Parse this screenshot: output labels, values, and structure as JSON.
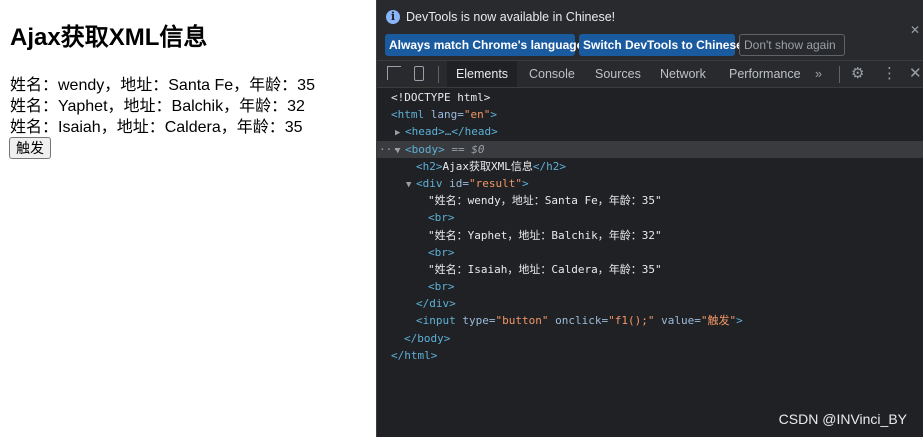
{
  "page": {
    "heading": "Ajax获取XML信息",
    "results": [
      "姓名：wendy，地址：Santa Fe，年龄：35",
      "姓名：Yaphet，地址：Balchik，年龄：32",
      "姓名：Isaiah，地址：Caldera，年龄：35"
    ],
    "button_label": "触发"
  },
  "devtools": {
    "infobar": {
      "message": "DevTools is now available in Chinese!",
      "match_label": "Always match Chrome's language",
      "switch_label": "Switch DevTools to Chinese",
      "dont_label": "Don't show again"
    },
    "tabs": {
      "elements": "Elements",
      "console": "Console",
      "sources": "Sources",
      "network": "Network",
      "performance": "Performance",
      "more": "»"
    },
    "icons": {
      "info": "info-icon",
      "close": "close-icon",
      "inspect": "inspect-element-icon",
      "device": "device-toolbar-icon",
      "settings": "gear-icon",
      "menu": "kebab-menu-icon"
    },
    "dom": {
      "doctype": "<!DOCTYPE html>",
      "html_open": "<html",
      "lang_attr": "lang",
      "lang_val": "\"en\"",
      "head": "<head>…</head>",
      "body_open": "<body>",
      "body_eq": "== $0",
      "h2_open": "<h2>",
      "h2_text": "Ajax获取XML信息",
      "h2_close": "</h2>",
      "div_open": "<div",
      "id_attr": "id",
      "id_val": "\"result\"",
      "row1": "\"姓名：wendy，地址：Santa Fe，年龄：35\"",
      "row2": "\"姓名：Yaphet，地址：Balchik，年龄：32\"",
      "row3": "\"姓名：Isaiah，地址：Caldera，年龄：35\"",
      "br": "<br>",
      "div_close": "</div>",
      "input_open": "<input",
      "type_attr": "type",
      "type_val": "\"button\"",
      "onclick_attr": "onclick",
      "onclick_val": "\"f1();\"",
      "value_attr": "value",
      "value_val": "\"触发\"",
      "gt": ">",
      "body_close": "</body>",
      "html_close": "</html>",
      "dots": "···"
    },
    "watermark": "CSDN @INVinci_BY"
  },
  "colors": {
    "devtools_bg": "#202124",
    "tag": "#5db0d7",
    "attr_name": "#9bbbdc",
    "attr_value": "#f29766",
    "button_blue": "#1a5ba0"
  }
}
